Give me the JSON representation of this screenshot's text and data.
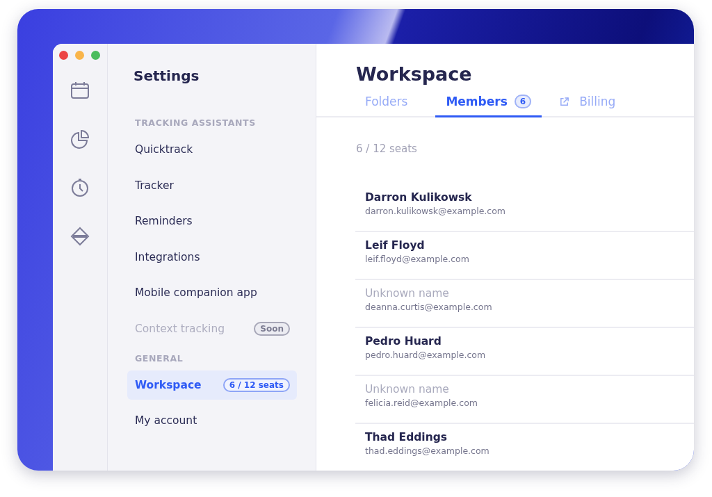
{
  "sidebar": {
    "title": "Settings",
    "sections": [
      {
        "heading": "TRACKING ASSISTANTS",
        "items": [
          {
            "label": "Quicktrack",
            "selected": false,
            "disabled": false
          },
          {
            "label": "Tracker",
            "selected": false,
            "disabled": false
          },
          {
            "label": "Reminders",
            "selected": false,
            "disabled": false
          },
          {
            "label": "Integrations",
            "selected": false,
            "disabled": false
          },
          {
            "label": "Mobile companion app",
            "selected": false,
            "disabled": false
          },
          {
            "label": "Context tracking",
            "selected": false,
            "disabled": true,
            "badge": "Soon"
          }
        ]
      },
      {
        "heading": "GENERAL",
        "items": [
          {
            "label": "Workspace",
            "selected": true,
            "disabled": false,
            "badge": "6 / 12 seats"
          },
          {
            "label": "My account",
            "selected": false,
            "disabled": false
          }
        ]
      }
    ]
  },
  "main": {
    "title": "Workspace",
    "tabs": [
      {
        "label": "Folders",
        "selected": false
      },
      {
        "label": "Members",
        "selected": true,
        "count": "6"
      },
      {
        "label": "Billing",
        "selected": false,
        "external": true
      }
    ],
    "seats": "6 / 12 seats",
    "members": [
      {
        "name": "Darron Kulikowsk",
        "email": "darron.kulikowsk@example.com",
        "unknown": false
      },
      {
        "name": "Leif Floyd",
        "email": "leif.floyd@example.com",
        "unknown": false
      },
      {
        "name": "Unknown name",
        "email": "deanna.curtis@example.com",
        "unknown": true
      },
      {
        "name": "Pedro Huard",
        "email": "pedro.huard@example.com",
        "unknown": false
      },
      {
        "name": "Unknown name",
        "email": "felicia.reid@example.com",
        "unknown": true
      },
      {
        "name": "Thad Eddings",
        "email": "thad.eddings@example.com",
        "unknown": false
      }
    ]
  }
}
